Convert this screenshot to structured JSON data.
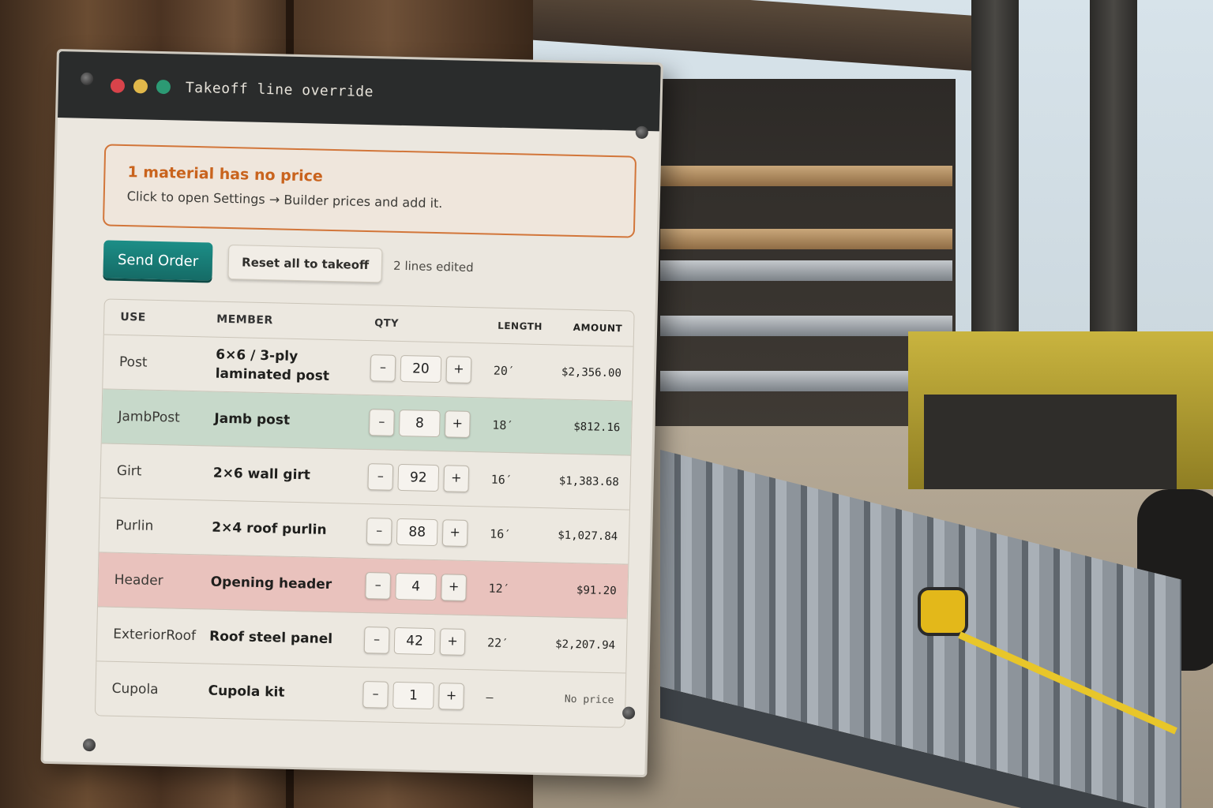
{
  "window": {
    "title": "Takeoff line override"
  },
  "alert": {
    "title": "1 material has no price",
    "body": "Click to open Settings → Builder prices and add it."
  },
  "actions": {
    "send_label": "Send Order",
    "reset_label": "Reset all to takeoff",
    "edited_text": "2 lines edited"
  },
  "table": {
    "headers": {
      "use": "USE",
      "member": "MEMBER",
      "qty": "QTY",
      "length": "LENGTH",
      "amount": "AMOUNT"
    },
    "rows": [
      {
        "use": "Post",
        "member": "6×6 / 3-ply laminated post",
        "qty": "20",
        "length": "20′",
        "amount": "$2,356.00",
        "state": "normal"
      },
      {
        "use": "JambPost",
        "member": "Jamb post",
        "qty": "8",
        "length": "18′",
        "amount": "$812.16",
        "state": "edited"
      },
      {
        "use": "Girt",
        "member": "2×6 wall girt",
        "qty": "92",
        "length": "16′",
        "amount": "$1,383.68",
        "state": "normal"
      },
      {
        "use": "Purlin",
        "member": "2×4 roof purlin",
        "qty": "88",
        "length": "16′",
        "amount": "$1,027.84",
        "state": "normal"
      },
      {
        "use": "Header",
        "member": "Opening header",
        "qty": "4",
        "length": "12′",
        "amount": "$91.20",
        "state": "edited-warn"
      },
      {
        "use": "ExteriorRoof",
        "member": "Roof steel panel",
        "qty": "42",
        "length": "22′",
        "amount": "$2,207.94",
        "state": "normal"
      },
      {
        "use": "Cupola",
        "member": "Cupola kit",
        "qty": "1",
        "length": "–",
        "amount": "No price",
        "state": "normal"
      }
    ],
    "stepper": {
      "minus": "–",
      "plus": "+"
    }
  },
  "colors": {
    "accent": "#1c8e87",
    "alert": "#d2763a",
    "edited_row": "#c7d9ca",
    "warn_row": "#e9c2bd"
  }
}
